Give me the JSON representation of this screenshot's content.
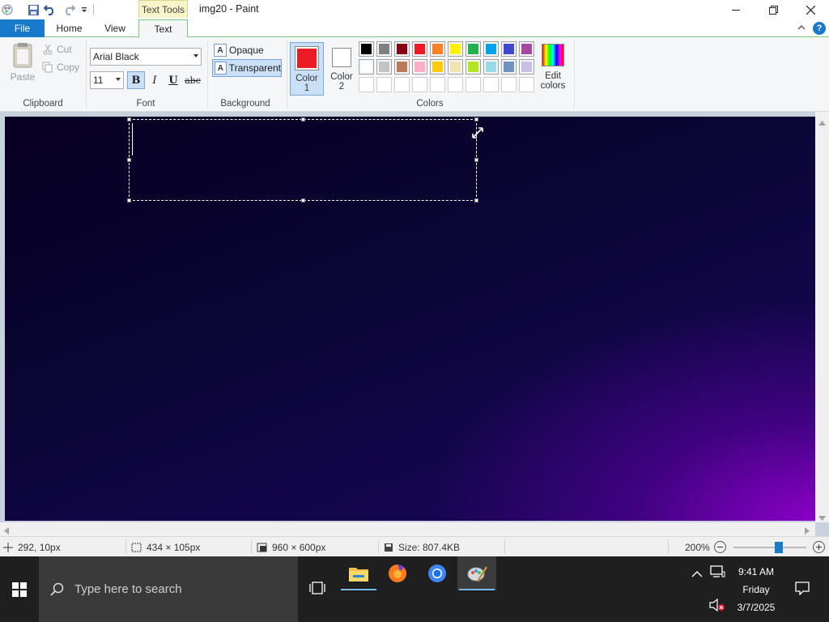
{
  "window": {
    "title": "img20 - Paint",
    "contextual_tab": "Text Tools"
  },
  "tabs": [
    {
      "label": "File",
      "active": false
    },
    {
      "label": "Home",
      "active": false
    },
    {
      "label": "View",
      "active": false
    },
    {
      "label": "Text",
      "active": true
    }
  ],
  "ribbon": {
    "clipboard": {
      "paste": "Paste",
      "cut": "Cut",
      "copy": "Copy",
      "label": "Clipboard"
    },
    "font": {
      "family": "Arial Black",
      "size": "11",
      "bold": "B",
      "italic": "I",
      "underline": "U",
      "strike": "abc",
      "label": "Font"
    },
    "background": {
      "opaque": "Opaque",
      "transparent": "Transparent",
      "label": "Background"
    },
    "colors": {
      "color1_label": "Color",
      "color1_num": "1",
      "color2_label": "Color",
      "color2_num": "2",
      "edit_label": "Edit",
      "edit_label2": "colors",
      "label": "Colors",
      "color1": "#ed1c24",
      "color2": "#ffffff",
      "palette_row1": [
        "#000000",
        "#7f7f7f",
        "#880015",
        "#ed1c24",
        "#ff7f27",
        "#fff200",
        "#22b14c",
        "#00a2e8",
        "#3f48cc",
        "#a349a4"
      ],
      "palette_row2": [
        "#ffffff",
        "#c3c3c3",
        "#b97a57",
        "#ffaec9",
        "#ffc90e",
        "#efe4b0",
        "#b5e61d",
        "#99d9ea",
        "#7092be",
        "#c8bfe7"
      ],
      "palette_row3": [
        "#ffffff",
        "#ffffff",
        "#ffffff",
        "#ffffff",
        "#ffffff",
        "#ffffff",
        "#ffffff",
        "#ffffff",
        "#ffffff",
        "#ffffff"
      ]
    }
  },
  "status": {
    "cursor": "292, 10px",
    "selection": "434 × 105px",
    "canvas_size": "960 × 600px",
    "file_size": "Size: 807.4KB",
    "zoom": "200%",
    "zoom_level": 0.64
  },
  "taskbar": {
    "search_placeholder": "Type here to search",
    "time": "9:41 AM",
    "day": "Friday",
    "date": "3/7/2025"
  },
  "icons": {
    "paint": "paint-icon",
    "save": "save-icon",
    "undo": "undo-icon",
    "redo": "redo-icon"
  }
}
